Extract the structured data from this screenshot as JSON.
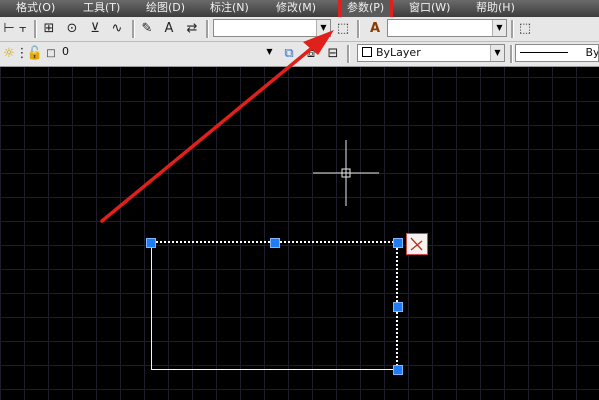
{
  "menu": {
    "format": "格式(O)",
    "tools": "工具(T)",
    "draw": "绘图(D)",
    "dimension": "标注(N)",
    "modify": "修改(M)",
    "parameters": "参数(P)",
    "window": "窗口(W)",
    "help": "帮助(H)"
  },
  "toolbar1": {
    "style_combo_value": "",
    "layer_combo_value": ""
  },
  "toolbar2": {
    "layer_name": "0",
    "color_combo": "ByLayer",
    "linetype_combo": "ByL"
  },
  "colors": {
    "highlight_box": "#e0201a",
    "arrow": "#e0201a",
    "grip": "#1e7df2",
    "canvas": "#000000"
  },
  "icons": {
    "constraint_badge": "perpendicular-constraint-icon"
  }
}
